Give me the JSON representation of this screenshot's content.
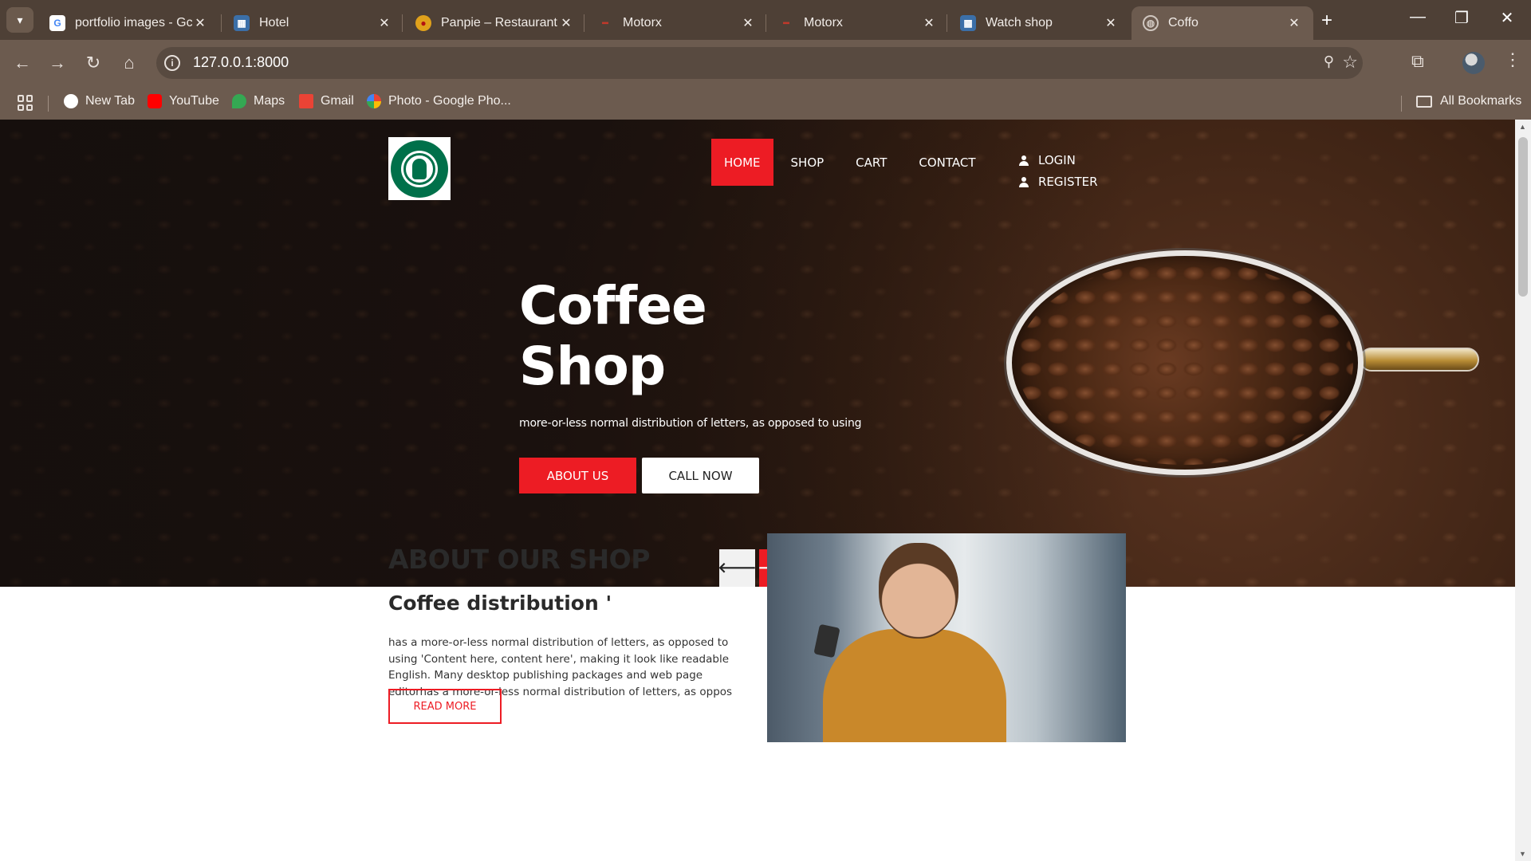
{
  "browser": {
    "tabs": [
      {
        "title": "portfolio images - Gc",
        "favicon": "google-icon",
        "active": false
      },
      {
        "title": "Hotel",
        "favicon": "page-icon",
        "active": false
      },
      {
        "title": "Panpie – Restaurant V",
        "favicon": "panpie-icon",
        "active": false
      },
      {
        "title": "Motorx",
        "favicon": "motorx-icon",
        "active": false
      },
      {
        "title": "Motorx",
        "favicon": "motorx-icon",
        "active": false
      },
      {
        "title": "Watch shop",
        "favicon": "page-icon",
        "active": false
      },
      {
        "title": "Coffo",
        "favicon": "globe-icon",
        "active": true
      }
    ],
    "url": "127.0.0.1:8000",
    "bookmarks": [
      {
        "label": "New Tab",
        "icon": "globe-icon"
      },
      {
        "label": "YouTube",
        "icon": "youtube-icon"
      },
      {
        "label": "Maps",
        "icon": "maps-icon"
      },
      {
        "label": "Gmail",
        "icon": "gmail-icon"
      },
      {
        "label": "Photo - Google Pho...",
        "icon": "photos-icon"
      }
    ],
    "all_bookmarks": "All Bookmarks"
  },
  "site": {
    "logo_alt": "STARBUCKS COFFEE",
    "nav": [
      {
        "label": "HOME",
        "active": true
      },
      {
        "label": "SHOP",
        "active": false
      },
      {
        "label": "CART",
        "active": false
      },
      {
        "label": "CONTACT",
        "active": false
      }
    ],
    "auth": {
      "login": "LOGIN",
      "register": "REGISTER"
    },
    "hero": {
      "title_line1": "Coffee",
      "title_line2": "Shop",
      "subtitle": "more-or-less normal distribution of letters, as opposed to using",
      "btn_primary": "ABOUT US",
      "btn_secondary": "CALL NOW",
      "prev_arrow": "🡐",
      "next_arrow": "🡒"
    },
    "about": {
      "heading": "ABOUT OUR SHOP",
      "subheading": "Coffee distribution '",
      "body": "has a more-or-less normal distribution of letters, as opposed to using 'Content here, content here', making it look like readable English. Many desktop publishing packages and web page editorhas a more-or-less normal distribution of letters, as oppos",
      "button": "READ MORE"
    }
  },
  "colors": {
    "accent_red": "#ed1c24",
    "chrome_dark": "#4e4036",
    "chrome_mid": "#6c5b4f",
    "starbucks_green": "#00704a"
  }
}
